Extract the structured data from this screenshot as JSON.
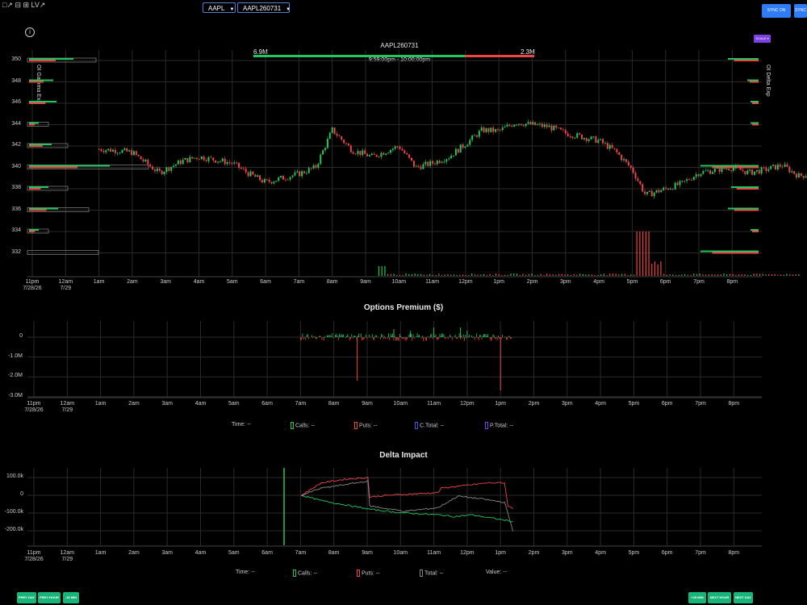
{
  "toolbar": {
    "icons": "□↗ ⊟ ⊞ LV↗"
  },
  "symbol_select": {
    "value": "AAPL"
  },
  "contract_select": {
    "value": "AAPL260731"
  },
  "sync_buttons": [
    "SYNC ON",
    "SYNC"
  ],
  "scale_button": "SCALE ▾",
  "top_chart": {
    "contract_label": "AAPL260731",
    "calls_total": "6.9M",
    "puts_total": "2.3M",
    "time_range": "9:59:00pm - 10:00:00pm",
    "left_axis_label": "OI Gamma Exp",
    "right_axis_label": "OI Delta Exp",
    "price_ticks": [
      "350",
      "348",
      "346",
      "344",
      "342",
      "340",
      "338",
      "336",
      "334",
      "332"
    ]
  },
  "time_ticks": [
    "11pm",
    "12am",
    "1am",
    "2am",
    "3am",
    "4am",
    "5am",
    "6am",
    "7am",
    "8am",
    "9am",
    "10am",
    "11am",
    "12pm",
    "1pm",
    "2pm",
    "3pm",
    "4pm",
    "5pm",
    "6pm",
    "7pm",
    "8pm"
  ],
  "date_ticks": [
    "7/28/26",
    "7/29"
  ],
  "premium_chart": {
    "title": "Options Premium ($)",
    "y_ticks": [
      "0",
      "-1.0M",
      "-2.0M",
      "-3.0M"
    ],
    "legend": [
      {
        "label": "Time:",
        "value": "--",
        "color": ""
      },
      {
        "label": "Calls:",
        "value": "--",
        "color": "#22c55e"
      },
      {
        "label": "Puts:",
        "value": "--",
        "color": "#ef4444"
      },
      {
        "label": "C.Total:",
        "value": "--",
        "color": "#3b5bdb"
      },
      {
        "label": "P.Total:",
        "value": "--",
        "color": "#7c3aed"
      }
    ]
  },
  "delta_chart": {
    "title": "Delta Impact",
    "y_ticks": [
      "100.0k",
      "0",
      "-100.0k",
      "-200.0k"
    ],
    "legend": [
      {
        "label": "Time:",
        "value": "--",
        "color": ""
      },
      {
        "label": "Calls:",
        "value": "--",
        "color": "#22c55e"
      },
      {
        "label": "Puts:",
        "value": "--",
        "color": "#ef4444"
      },
      {
        "label": "Total:",
        "value": "--",
        "color": "#888888"
      },
      {
        "label": "Value:",
        "value": "--",
        "color": ""
      }
    ]
  },
  "nav_left": [
    "PREV DAY",
    "PREV HOUR",
    "-15 MIN"
  ],
  "nav_right": [
    "+15 MIN",
    "NEXT HOUR",
    "NEXT DAY"
  ],
  "colors": {
    "up": "#22c55e",
    "down": "#ef4444",
    "grid": "#2a2a2a",
    "accent": "#2f7df6"
  }
}
